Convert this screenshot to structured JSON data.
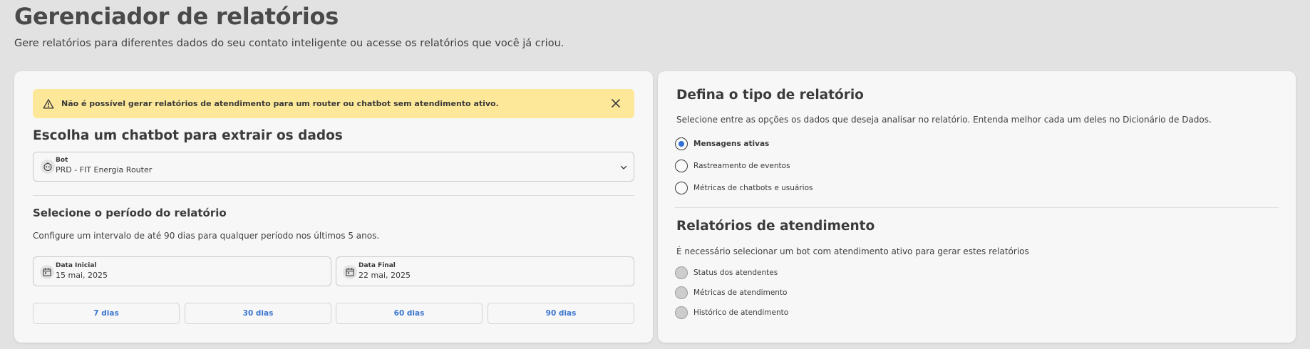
{
  "header": {
    "title": "Gerenciador de relatórios",
    "subtitle": "Gere relatórios para diferentes dados do seu contato inteligente ou acesse os relatórios que você já criou."
  },
  "left_card": {
    "alert": {
      "text": "Não é possível gerar relatórios de atendimento para um router ou chatbot sem atendimento ativo.",
      "icon": "warning-icon",
      "close_icon": "close-icon"
    },
    "chatbot_section": {
      "title": "Escolha um chatbot para extrair os dados",
      "field_label": "Bot",
      "field_value": "PRD - FIT Energia Router"
    },
    "period_section": {
      "title": "Selecione o período do relatório",
      "description": "Configure um intervalo de até 90 dias para qualquer período nos últimos 5 anos.",
      "start_label": "Data Inicial",
      "start_value": "15 mai, 2025",
      "end_label": "Data Final",
      "end_value": "22 mai, 2025",
      "presets": [
        "7 dias",
        "30 dias",
        "60 dias",
        "90 dias"
      ]
    }
  },
  "right_card": {
    "type_section": {
      "title": "Defina o tipo de relatório",
      "description": "Selecione entre as opções os dados que deseja analisar no relatório. Entenda melhor cada um deles no Dicionário de Dados.",
      "options": [
        {
          "label": "Mensagens ativas",
          "selected": true
        },
        {
          "label": "Rastreamento de eventos",
          "selected": false
        },
        {
          "label": "Métricas de chatbots e usuários",
          "selected": false
        }
      ]
    },
    "attendance_section": {
      "title": "Relatórios de atendimento",
      "description": "É necessário selecionar um bot com atendimento ativo para gerar estes relatórios",
      "options": [
        {
          "label": "Status dos atendentes",
          "disabled": true
        },
        {
          "label": "Métricas de atendimento",
          "disabled": true
        },
        {
          "label": "Histórico de atendimento",
          "disabled": true
        }
      ]
    }
  },
  "colors": {
    "accent": "#2f6fd6",
    "link": "#3b76d0",
    "alert_bg": "#fde89a",
    "page_bg": "#e2e2e2",
    "card_bg": "#f7f7f7"
  }
}
